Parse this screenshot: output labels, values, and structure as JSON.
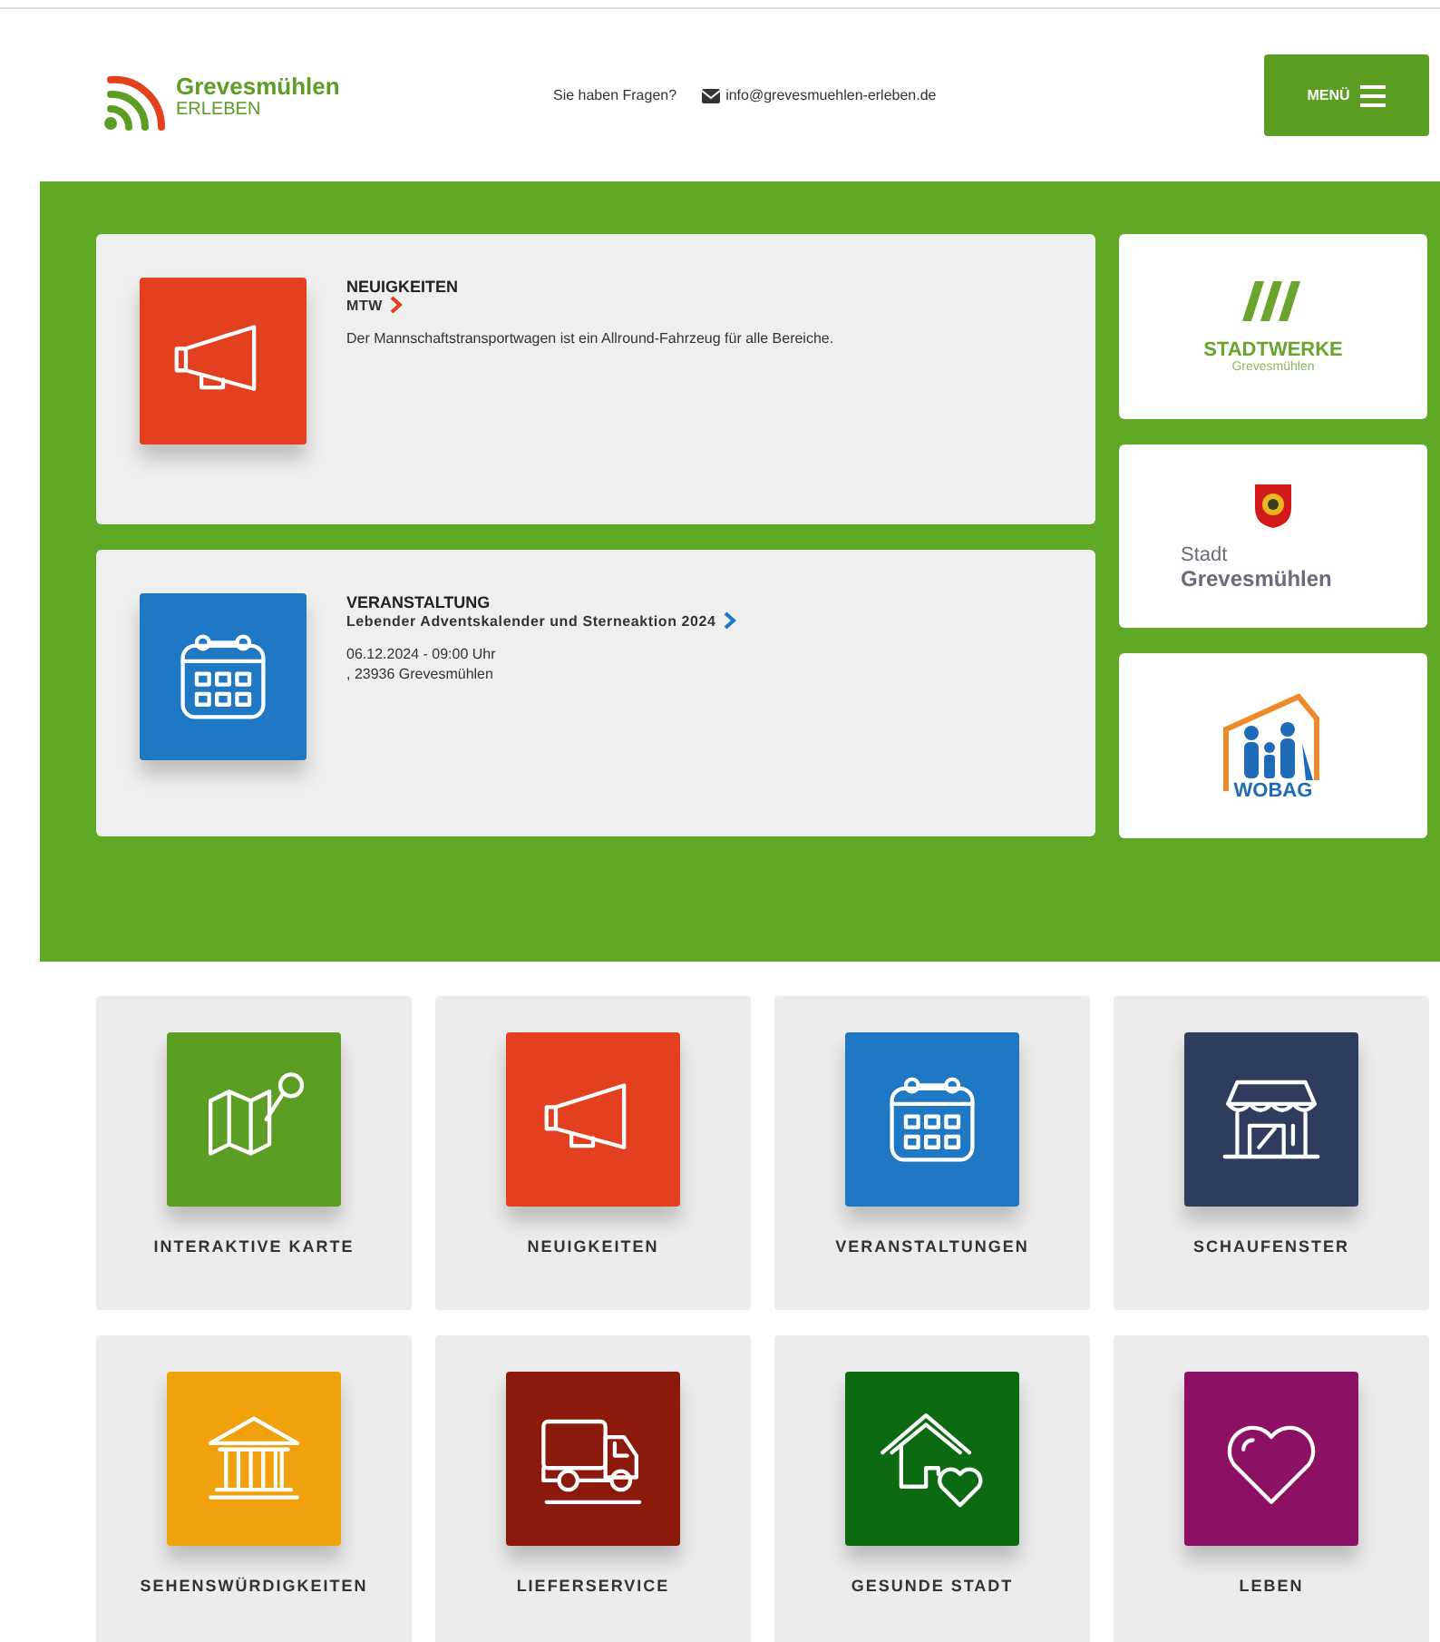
{
  "header": {
    "logo": {
      "name": "Grevesmühlen",
      "tagline": "ERLEBEN"
    },
    "question": "Sie haben Fragen?",
    "email": "info@grevesmuehlen-erleben.de",
    "menu_button": "MENÜ"
  },
  "feature_cards": [
    {
      "kind": "megaphone",
      "color": "#e2401f",
      "category": "NEUIGKEITEN",
      "title": "MTW",
      "lines": [
        "Der Mannschaftstransportwagen ist ein Allround-Fahrzeug für alle Bereiche."
      ]
    },
    {
      "kind": "calendar",
      "color": "#1f78c4",
      "category": "VERANSTALTUNG",
      "title": "Lebender Adventskalender und Sterneaktion 2024",
      "lines": [
        "06.12.2024 - 09:00 Uhr",
        ", 23936 Grevesmühlen"
      ]
    }
  ],
  "partners": [
    {
      "kind": "stadtwerke",
      "name": "STADTWERKE",
      "place": "Grevesmühlen"
    },
    {
      "kind": "stadt",
      "name": "Stadt",
      "place": "Grevesmühlen"
    },
    {
      "kind": "wobag",
      "name": "WOBAG"
    }
  ],
  "tiles": [
    {
      "kind": "map",
      "color": "#5c9e24",
      "label": "INTERAKTIVE KARTE"
    },
    {
      "kind": "megaphone",
      "color": "#e2401f",
      "label": "NEUIGKEITEN"
    },
    {
      "kind": "calendar",
      "color": "#1f78c4",
      "label": "VERANSTALTUNGEN"
    },
    {
      "kind": "shop",
      "color": "#2e3c5e",
      "label": "SCHAUFENSTER"
    },
    {
      "kind": "museum",
      "color": "#f0a10c",
      "label": "SEHENSWÜRDIGKEITEN"
    },
    {
      "kind": "truck",
      "color": "#8c1a0c",
      "label": "LIEFERSERVICE"
    },
    {
      "kind": "house-heart",
      "color": "#0c6b12",
      "label": "GESUNDE STADT"
    },
    {
      "kind": "heart",
      "color": "#8c1064",
      "label": "LEBEN"
    }
  ]
}
